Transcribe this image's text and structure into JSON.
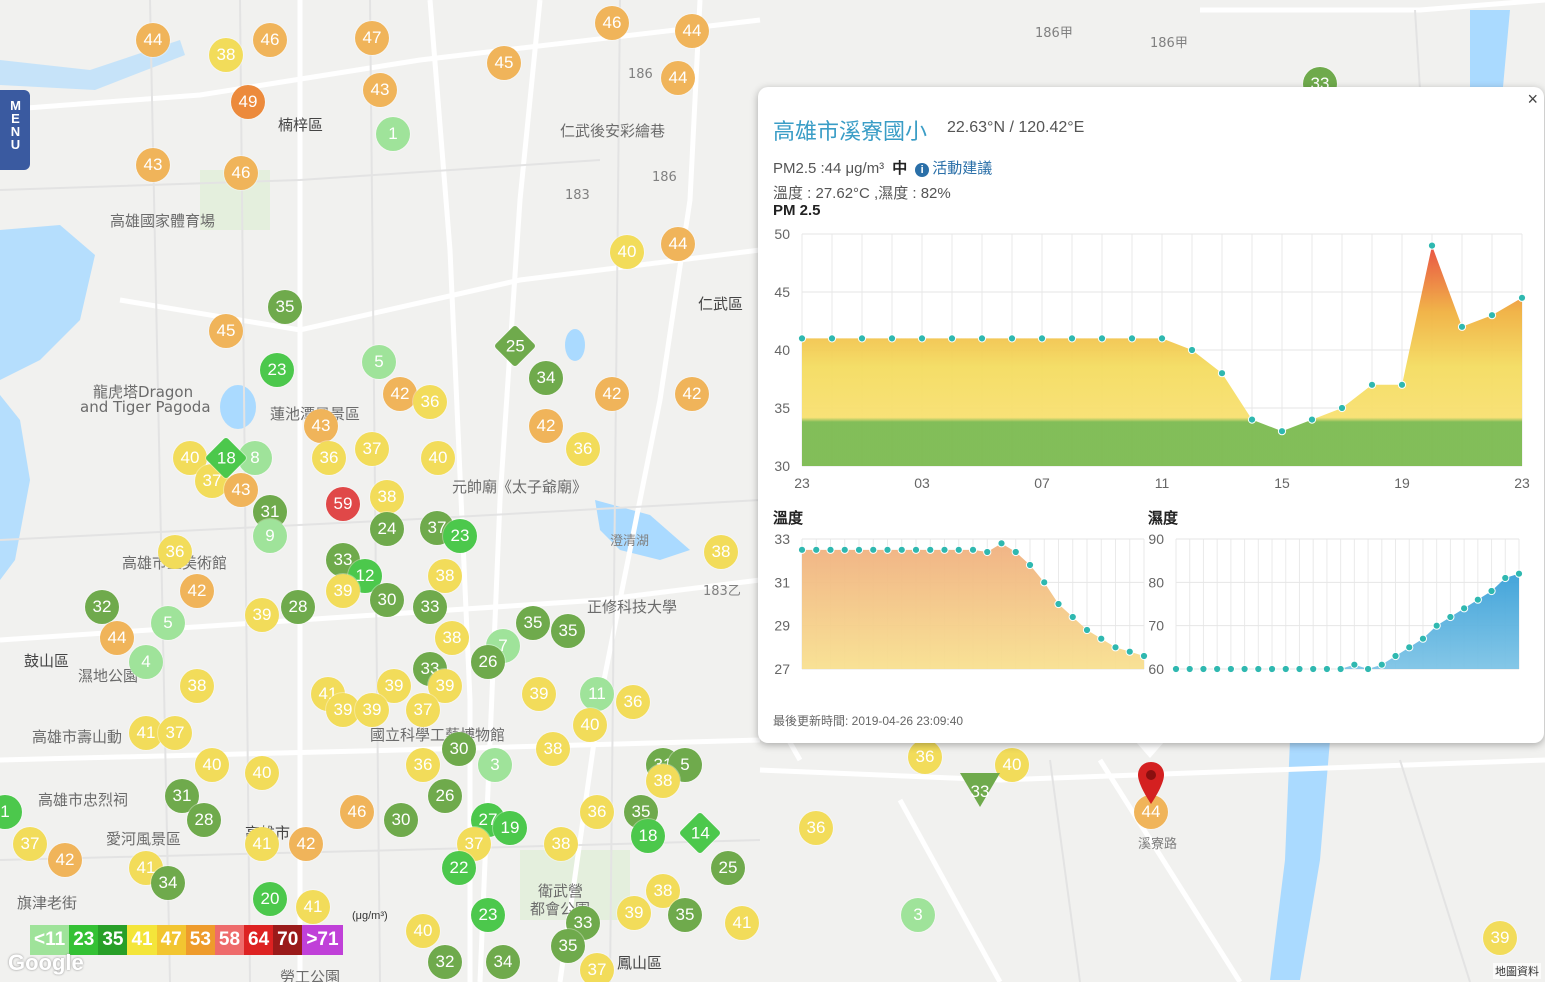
{
  "menu": {
    "label": "MENU"
  },
  "map_labels": [
    {
      "text": "楠梓區",
      "x": 278,
      "y": 114,
      "cls": "dark"
    },
    {
      "text": "高雄國家體育場",
      "x": 110,
      "y": 210,
      "cls": ""
    },
    {
      "text": "仁武後安彩繪巷",
      "x": 560,
      "y": 120,
      "cls": ""
    },
    {
      "text": "仁武區",
      "x": 698,
      "y": 293,
      "cls": "dark"
    },
    {
      "text": "龍虎塔Dragon",
      "x": 93,
      "y": 381,
      "cls": ""
    },
    {
      "text": "and Tiger Pagoda",
      "x": 80,
      "y": 398,
      "cls": ""
    },
    {
      "text": "蓮池潭風景區",
      "x": 270,
      "y": 403,
      "cls": ""
    },
    {
      "text": "高雄市立美術館",
      "x": 122,
      "y": 552,
      "cls": ""
    },
    {
      "text": "正修科技大學",
      "x": 587,
      "y": 596,
      "cls": ""
    },
    {
      "text": "鼓山區",
      "x": 24,
      "y": 650,
      "cls": "dark"
    },
    {
      "text": "濕地公園",
      "x": 78,
      "y": 665,
      "cls": ""
    },
    {
      "text": "高雄市壽山動",
      "x": 32,
      "y": 726,
      "cls": ""
    },
    {
      "text": "國立科學工藝博物館",
      "x": 370,
      "y": 724,
      "cls": ""
    },
    {
      "text": "高雄市忠烈祠",
      "x": 38,
      "y": 789,
      "cls": ""
    },
    {
      "text": "愛河風景區",
      "x": 106,
      "y": 828,
      "cls": ""
    },
    {
      "text": "高雄市",
      "x": 245,
      "y": 822,
      "cls": "dark"
    },
    {
      "text": "旗津老街",
      "x": 17,
      "y": 892,
      "cls": ""
    },
    {
      "text": "衛武營",
      "x": 538,
      "y": 880,
      "cls": ""
    },
    {
      "text": "都會公園",
      "x": 530,
      "y": 898,
      "cls": ""
    },
    {
      "text": "鳳山區",
      "x": 617,
      "y": 952,
      "cls": "dark"
    },
    {
      "text": "勞工公園",
      "x": 280,
      "y": 966,
      "cls": ""
    },
    {
      "text": "元帥廟《太子爺廟》",
      "x": 452,
      "y": 476,
      "cls": ""
    },
    {
      "text": "澄清湖",
      "x": 610,
      "y": 530,
      "cls": "small"
    },
    {
      "text": "186甲",
      "x": 1150,
      "y": 32,
      "cls": "small"
    },
    {
      "text": "186甲",
      "x": 1035,
      "y": 22,
      "cls": "small"
    },
    {
      "text": "183乙",
      "x": 703,
      "y": 580,
      "cls": "small"
    },
    {
      "text": "183",
      "x": 565,
      "y": 188,
      "cls": "small"
    },
    {
      "text": "186",
      "x": 628,
      "y": 67,
      "cls": "small"
    },
    {
      "text": "186",
      "x": 652,
      "y": 170,
      "cls": "small"
    },
    {
      "text": "溪寮路",
      "x": 1138,
      "y": 833,
      "cls": "small"
    }
  ],
  "markers": [
    {
      "v": "44",
      "x": 153,
      "y": 40,
      "c": "#f0b45a"
    },
    {
      "v": "38",
      "x": 226,
      "y": 55,
      "c": "#f2dc5a"
    },
    {
      "v": "46",
      "x": 270,
      "y": 40,
      "c": "#f0b45a"
    },
    {
      "v": "47",
      "x": 372,
      "y": 38,
      "c": "#f0b45a"
    },
    {
      "v": "46",
      "x": 612,
      "y": 23,
      "c": "#f0b45a"
    },
    {
      "v": "44",
      "x": 692,
      "y": 31,
      "c": "#f0b45a"
    },
    {
      "v": "45",
      "x": 504,
      "y": 63,
      "c": "#f0b45a"
    },
    {
      "v": "44",
      "x": 678,
      "y": 78,
      "c": "#f0b45a"
    },
    {
      "v": "43",
      "x": 380,
      "y": 90,
      "c": "#f0b45a"
    },
    {
      "v": "49",
      "x": 248,
      "y": 102,
      "c": "#ec8a3c"
    },
    {
      "v": "1",
      "x": 393,
      "y": 134,
      "c": "#9fe39a"
    },
    {
      "v": "43",
      "x": 153,
      "y": 165,
      "c": "#f0b45a"
    },
    {
      "v": "46",
      "x": 241,
      "y": 173,
      "c": "#f0b45a"
    },
    {
      "v": "40",
      "x": 627,
      "y": 252,
      "c": "#f2dc5a"
    },
    {
      "v": "44",
      "x": 678,
      "y": 244,
      "c": "#f0b45a"
    },
    {
      "v": "35",
      "x": 285,
      "y": 307,
      "c": "#6faa4c"
    },
    {
      "v": "45",
      "x": 226,
      "y": 331,
      "c": "#f0b45a"
    },
    {
      "v": "5",
      "x": 379,
      "y": 362,
      "c": "#9fe39a"
    },
    {
      "v": "23",
      "x": 277,
      "y": 370,
      "c": "#4cc84c"
    },
    {
      "v": "34",
      "x": 546,
      "y": 378,
      "c": "#6faa4c"
    },
    {
      "v": "42",
      "x": 400,
      "y": 394,
      "c": "#f0b45a"
    },
    {
      "v": "36",
      "x": 430,
      "y": 402,
      "c": "#f2dc5a"
    },
    {
      "v": "42",
      "x": 612,
      "y": 394,
      "c": "#f0b45a"
    },
    {
      "v": "42",
      "x": 692,
      "y": 394,
      "c": "#f0b45a"
    },
    {
      "v": "43",
      "x": 321,
      "y": 426,
      "c": "#f0b45a"
    },
    {
      "v": "42",
      "x": 546,
      "y": 426,
      "c": "#f0b45a"
    },
    {
      "v": "36",
      "x": 583,
      "y": 449,
      "c": "#f2dc5a"
    },
    {
      "v": "40",
      "x": 190,
      "y": 458,
      "c": "#f2dc5a"
    },
    {
      "v": "8",
      "x": 255,
      "y": 458,
      "c": "#9fe39a"
    },
    {
      "v": "36",
      "x": 329,
      "y": 458,
      "c": "#f2dc5a"
    },
    {
      "v": "37",
      "x": 372,
      "y": 449,
      "c": "#f2dc5a"
    },
    {
      "v": "40",
      "x": 438,
      "y": 458,
      "c": "#f2dc5a"
    },
    {
      "v": "37",
      "x": 212,
      "y": 481,
      "c": "#f2dc5a"
    },
    {
      "v": "43",
      "x": 241,
      "y": 490,
      "c": "#f0b45a"
    },
    {
      "v": "59",
      "x": 343,
      "y": 504,
      "c": "#e04848"
    },
    {
      "v": "38",
      "x": 387,
      "y": 497,
      "c": "#f2dc5a"
    },
    {
      "v": "31",
      "x": 270,
      "y": 512,
      "c": "#6faa4c"
    },
    {
      "v": "24",
      "x": 387,
      "y": 529,
      "c": "#6faa4c"
    },
    {
      "v": "37",
      "x": 437,
      "y": 528,
      "c": "#6faa4c"
    },
    {
      "v": "23",
      "x": 460,
      "y": 536,
      "c": "#4cc84c"
    },
    {
      "v": "9",
      "x": 270,
      "y": 536,
      "c": "#9fe39a"
    },
    {
      "v": "36",
      "x": 175,
      "y": 552,
      "c": "#f2dc5a"
    },
    {
      "v": "33",
      "x": 343,
      "y": 560,
      "c": "#6faa4c"
    },
    {
      "v": "12",
      "x": 365,
      "y": 576,
      "c": "#4cc84c"
    },
    {
      "v": "38",
      "x": 445,
      "y": 576,
      "c": "#f2dc5a"
    },
    {
      "v": "38",
      "x": 721,
      "y": 552,
      "c": "#f2dc5a"
    },
    {
      "v": "42",
      "x": 197,
      "y": 591,
      "c": "#f0b45a"
    },
    {
      "v": "30",
      "x": 387,
      "y": 600,
      "c": "#6faa4c"
    },
    {
      "v": "33",
      "x": 430,
      "y": 607,
      "c": "#6faa4c"
    },
    {
      "v": "32",
      "x": 102,
      "y": 607,
      "c": "#6faa4c"
    },
    {
      "v": "39",
      "x": 262,
      "y": 615,
      "c": "#f2dc5a"
    },
    {
      "v": "28",
      "x": 298,
      "y": 607,
      "c": "#6faa4c"
    },
    {
      "v": "39",
      "x": 343,
      "y": 591,
      "c": "#f2dc5a"
    },
    {
      "v": "5",
      "x": 168,
      "y": 623,
      "c": "#9fe39a"
    },
    {
      "v": "35",
      "x": 533,
      "y": 623,
      "c": "#6faa4c"
    },
    {
      "v": "35",
      "x": 568,
      "y": 631,
      "c": "#6faa4c"
    },
    {
      "v": "44",
      "x": 117,
      "y": 638,
      "c": "#f0b45a"
    },
    {
      "v": "38",
      "x": 452,
      "y": 638,
      "c": "#f2dc5a"
    },
    {
      "v": "7",
      "x": 503,
      "y": 646,
      "c": "#9fe39a"
    },
    {
      "v": "4",
      "x": 146,
      "y": 662,
      "c": "#9fe39a"
    },
    {
      "v": "33",
      "x": 430,
      "y": 669,
      "c": "#6faa4c"
    },
    {
      "v": "26",
      "x": 488,
      "y": 662,
      "c": "#6faa4c"
    },
    {
      "v": "38",
      "x": 197,
      "y": 686,
      "c": "#f2dc5a"
    },
    {
      "v": "41",
      "x": 328,
      "y": 694,
      "c": "#f2dc5a"
    },
    {
      "v": "39",
      "x": 394,
      "y": 686,
      "c": "#f2dc5a"
    },
    {
      "v": "39",
      "x": 445,
      "y": 686,
      "c": "#f2dc5a"
    },
    {
      "v": "39",
      "x": 539,
      "y": 694,
      "c": "#f2dc5a"
    },
    {
      "v": "11",
      "x": 597,
      "y": 694,
      "c": "#9fe39a"
    },
    {
      "v": "36",
      "x": 633,
      "y": 702,
      "c": "#f2dc5a"
    },
    {
      "v": "39",
      "x": 343,
      "y": 710,
      "c": "#f2dc5a"
    },
    {
      "v": "39",
      "x": 372,
      "y": 710,
      "c": "#f2dc5a"
    },
    {
      "v": "37",
      "x": 423,
      "y": 710,
      "c": "#f2dc5a"
    },
    {
      "v": "40",
      "x": 590,
      "y": 725,
      "c": "#f2dc5a"
    },
    {
      "v": "41",
      "x": 146,
      "y": 733,
      "c": "#f2dc5a"
    },
    {
      "v": "37",
      "x": 175,
      "y": 733,
      "c": "#f2dc5a"
    },
    {
      "v": "30",
      "x": 459,
      "y": 749,
      "c": "#6faa4c"
    },
    {
      "v": "38",
      "x": 553,
      "y": 749,
      "c": "#f2dc5a"
    },
    {
      "v": "40",
      "x": 212,
      "y": 765,
      "c": "#f2dc5a"
    },
    {
      "v": "40",
      "x": 262,
      "y": 773,
      "c": "#f2dc5a"
    },
    {
      "v": "36",
      "x": 423,
      "y": 765,
      "c": "#f2dc5a"
    },
    {
      "v": "3",
      "x": 495,
      "y": 765,
      "c": "#9fe39a"
    },
    {
      "v": "31",
      "x": 663,
      "y": 765,
      "c": "#6faa4c"
    },
    {
      "v": "5",
      "x": 685,
      "y": 765,
      "c": "#6faa4c"
    },
    {
      "v": "38",
      "x": 663,
      "y": 781,
      "c": "#f2dc5a"
    },
    {
      "v": "31",
      "x": 182,
      "y": 796,
      "c": "#6faa4c"
    },
    {
      "v": "26",
      "x": 445,
      "y": 796,
      "c": "#6faa4c"
    },
    {
      "v": "46",
      "x": 357,
      "y": 812,
      "c": "#f0b45a"
    },
    {
      "v": "30",
      "x": 401,
      "y": 820,
      "c": "#6faa4c"
    },
    {
      "v": "36",
      "x": 597,
      "y": 812,
      "c": "#f2dc5a"
    },
    {
      "v": "35",
      "x": 641,
      "y": 812,
      "c": "#6faa4c"
    },
    {
      "v": "28",
      "x": 204,
      "y": 820,
      "c": "#6faa4c"
    },
    {
      "v": "27",
      "x": 488,
      "y": 820,
      "c": "#4cc84c"
    },
    {
      "v": "19",
      "x": 510,
      "y": 828,
      "c": "#4cc84c"
    },
    {
      "v": "18",
      "x": 648,
      "y": 836,
      "c": "#4cc84c"
    },
    {
      "v": "1",
      "x": 5,
      "y": 812,
      "c": "#4cc84c"
    },
    {
      "v": "37",
      "x": 30,
      "y": 844,
      "c": "#f2dc5a"
    },
    {
      "v": "41",
      "x": 262,
      "y": 844,
      "c": "#f2dc5a"
    },
    {
      "v": "42",
      "x": 306,
      "y": 844,
      "c": "#f0b45a"
    },
    {
      "v": "37",
      "x": 474,
      "y": 844,
      "c": "#f2dc5a"
    },
    {
      "v": "38",
      "x": 561,
      "y": 844,
      "c": "#f2dc5a"
    },
    {
      "v": "42",
      "x": 65,
      "y": 860,
      "c": "#f0b45a"
    },
    {
      "v": "41",
      "x": 146,
      "y": 868,
      "c": "#f2dc5a"
    },
    {
      "v": "22",
      "x": 459,
      "y": 868,
      "c": "#4cc84c"
    },
    {
      "v": "25",
      "x": 728,
      "y": 868,
      "c": "#6faa4c"
    },
    {
      "v": "34",
      "x": 168,
      "y": 883,
      "c": "#6faa4c"
    },
    {
      "v": "38",
      "x": 663,
      "y": 891,
      "c": "#f2dc5a"
    },
    {
      "v": "20",
      "x": 270,
      "y": 899,
      "c": "#4cc84c"
    },
    {
      "v": "41",
      "x": 313,
      "y": 907,
      "c": "#f2dc5a"
    },
    {
      "v": "23",
      "x": 488,
      "y": 915,
      "c": "#4cc84c"
    },
    {
      "v": "33",
      "x": 583,
      "y": 923,
      "c": "#6faa4c"
    },
    {
      "v": "39",
      "x": 634,
      "y": 913,
      "c": "#f2dc5a"
    },
    {
      "v": "35",
      "x": 685,
      "y": 915,
      "c": "#6faa4c"
    },
    {
      "v": "41",
      "x": 742,
      "y": 923,
      "c": "#f2dc5a"
    },
    {
      "v": "40",
      "x": 423,
      "y": 931,
      "c": "#f2dc5a"
    },
    {
      "v": "35",
      "x": 568,
      "y": 946,
      "c": "#6faa4c"
    },
    {
      "v": "32",
      "x": 445,
      "y": 962,
      "c": "#6faa4c"
    },
    {
      "v": "34",
      "x": 503,
      "y": 962,
      "c": "#6faa4c"
    },
    {
      "v": "37",
      "x": 597,
      "y": 970,
      "c": "#f2dc5a"
    },
    {
      "v": "36",
      "x": 925,
      "y": 757,
      "c": "#f2dc5a"
    },
    {
      "v": "40",
      "x": 1012,
      "y": 765,
      "c": "#f2dc5a"
    },
    {
      "v": "36",
      "x": 816,
      "y": 828,
      "c": "#f2dc5a"
    },
    {
      "v": "3",
      "x": 918,
      "y": 915,
      "c": "#9fe39a"
    },
    {
      "v": "39",
      "x": 1500,
      "y": 938,
      "c": "#f2dc5a"
    },
    {
      "v": "44",
      "x": 1151,
      "y": 812,
      "c": "#f0b45a"
    },
    {
      "v": "33",
      "x": 1320,
      "y": 84,
      "c": "#6faa4c"
    }
  ],
  "diamonds": [
    {
      "v": "25",
      "x": 515,
      "y": 346,
      "c": "#6faa4c"
    },
    {
      "v": "18",
      "x": 226,
      "y": 458,
      "c": "#4cc84c"
    },
    {
      "v": "14",
      "x": 700,
      "y": 833,
      "c": "#4cc84c"
    }
  ],
  "triangles": [
    {
      "v": "33",
      "x": 980,
      "y": 787,
      "c": "#6faa4c"
    }
  ],
  "legend": [
    {
      "label": "<11",
      "color": "#9fe39a"
    },
    {
      "label": "23",
      "color": "#34c134"
    },
    {
      "label": "35",
      "color": "#289f28"
    },
    {
      "label": "41",
      "color": "#f4e53a"
    },
    {
      "label": "47",
      "color": "#f2c531"
    },
    {
      "label": "53",
      "color": "#ee9b2c"
    },
    {
      "label": "58",
      "color": "#ee6b6b"
    },
    {
      "label": "64",
      "color": "#dd2222"
    },
    {
      "label": "70",
      "color": "#9a1a1a"
    },
    {
      "label": ">71",
      "color": "#c040d8"
    }
  ],
  "legend_unit": "(μg/m³)",
  "google": "Google",
  "map_data_label": "地圖資料",
  "popup": {
    "station": "高雄市溪寮國小",
    "coords": "22.63°N / 120.42°E",
    "pm_text": "PM2.5 :44 μg/m³",
    "pm_level": "中",
    "advice": "活動建議",
    "weather": "溫度 : 27.62°C ,濕度 : 82%",
    "pm_title": "PM 2.5",
    "temp_title": "溫度",
    "hum_title": "濕度",
    "updated": "最後更新時間: 2019-04-26 23:09:40",
    "close": "×"
  },
  "chart_data": [
    {
      "type": "area",
      "title": "PM 2.5",
      "x_tick_labels": [
        "23",
        "03",
        "07",
        "11",
        "15",
        "19",
        "23"
      ],
      "ylim": [
        30,
        50
      ],
      "yticks": [
        30,
        35,
        40,
        45,
        50
      ],
      "grid": true,
      "series": [
        {
          "values": [
            41,
            41,
            41,
            41,
            41,
            41,
            41,
            41,
            41,
            41,
            41,
            41,
            41,
            40,
            38,
            34,
            33,
            34,
            35,
            37,
            37,
            49,
            42,
            43,
            44.5
          ]
        }
      ]
    },
    {
      "type": "area",
      "title": "溫度",
      "ylim": [
        27,
        33
      ],
      "yticks": [
        27,
        29,
        31,
        33
      ],
      "grid": true,
      "series": [
        {
          "values": [
            32.5,
            32.5,
            32.5,
            32.5,
            32.5,
            32.5,
            32.5,
            32.5,
            32.5,
            32.5,
            32.5,
            32.5,
            32.5,
            32.4,
            32.8,
            32.4,
            31.8,
            31.0,
            30.0,
            29.4,
            28.8,
            28.4,
            28.0,
            27.8,
            27.6
          ]
        }
      ]
    },
    {
      "type": "area",
      "title": "濕度",
      "ylim": [
        60,
        90
      ],
      "yticks": [
        60,
        70,
        80,
        90
      ],
      "grid": true,
      "series": [
        {
          "values": [
            60,
            60,
            60,
            60,
            60,
            60,
            60,
            60,
            60,
            60,
            60,
            60,
            60,
            61,
            60,
            61,
            63,
            65,
            67,
            70,
            72,
            74,
            76,
            78,
            81,
            82
          ]
        }
      ]
    }
  ]
}
